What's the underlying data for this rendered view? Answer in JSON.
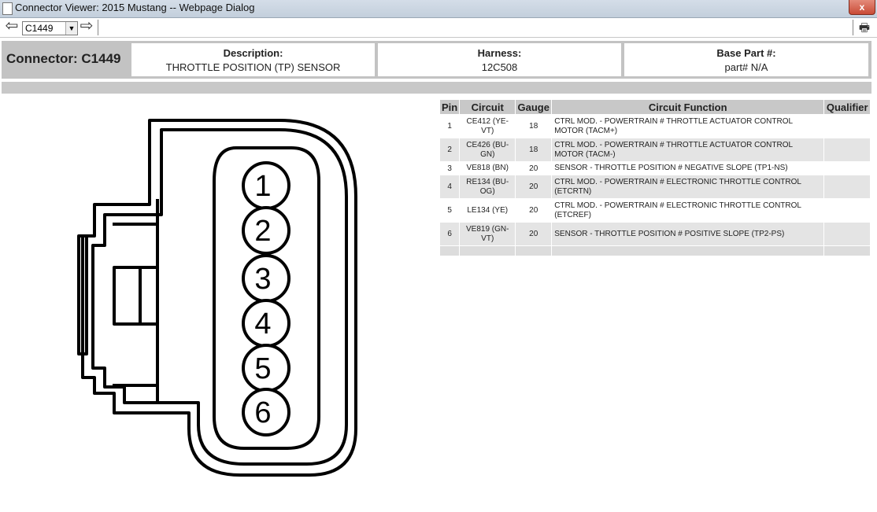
{
  "window": {
    "title": "Connector Viewer: 2015 Mustang -- Webpage Dialog",
    "close_label": "x"
  },
  "toolbar": {
    "back_glyph": "⇦",
    "forward_glyph": "⇨",
    "selected_connector": "C1449",
    "print_icon": "printer-icon"
  },
  "header": {
    "connector_label": "Connector: C1449",
    "description_label": "Description:",
    "description_value": "THROTTLE POSITION (TP) SENSOR",
    "harness_label": "Harness:",
    "harness_value": "12C508",
    "base_part_label": "Base Part #:",
    "base_part_value": "part# N/A"
  },
  "diagram": {
    "pins": [
      "1",
      "2",
      "3",
      "4",
      "5",
      "6"
    ]
  },
  "table": {
    "headers": {
      "pin": "Pin",
      "circuit": "Circuit",
      "gauge": "Gauge",
      "function": "Circuit Function",
      "qualifier": "Qualifier"
    },
    "rows": [
      {
        "pin": "1",
        "circuit": "CE412 (YE-VT)",
        "gauge": "18",
        "function": "CTRL MOD. - POWERTRAIN # THROTTLE ACTUATOR CONTROL MOTOR (TACM+)",
        "qualifier": ""
      },
      {
        "pin": "2",
        "circuit": "CE426 (BU-GN)",
        "gauge": "18",
        "function": "CTRL MOD. - POWERTRAIN # THROTTLE ACTUATOR CONTROL MOTOR (TACM-)",
        "qualifier": ""
      },
      {
        "pin": "3",
        "circuit": "VE818 (BN)",
        "gauge": "20",
        "function": "SENSOR - THROTTLE POSITION # NEGATIVE SLOPE (TP1-NS)",
        "qualifier": ""
      },
      {
        "pin": "4",
        "circuit": "RE134 (BU-OG)",
        "gauge": "20",
        "function": "CTRL MOD. - POWERTRAIN # ELECTRONIC THROTTLE CONTROL (ETCRTN)",
        "qualifier": ""
      },
      {
        "pin": "5",
        "circuit": "LE134 (YE)",
        "gauge": "20",
        "function": "CTRL MOD. - POWERTRAIN # ELECTRONIC THROTTLE CONTROL (ETCREF)",
        "qualifier": ""
      },
      {
        "pin": "6",
        "circuit": "VE819 (GN-VT)",
        "gauge": "20",
        "function": "SENSOR - THROTTLE POSITION # POSITIVE SLOPE (TP2-PS)",
        "qualifier": ""
      }
    ]
  }
}
